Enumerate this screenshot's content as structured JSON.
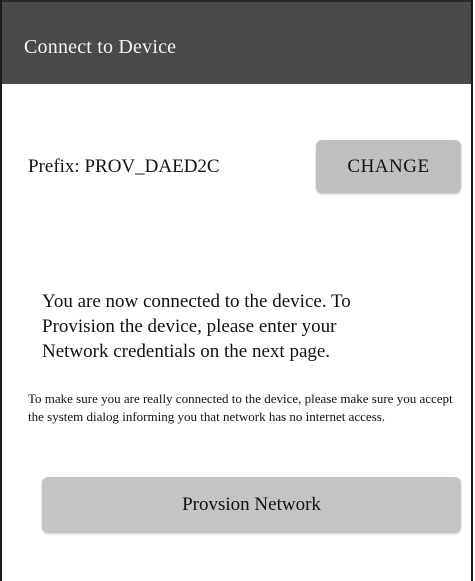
{
  "header": {
    "title": "Connect to Device"
  },
  "prefix": {
    "text": "Prefix: PROV_DAED2C",
    "change_label": "CHANGE"
  },
  "message": {
    "primary": "You are now connected to the device. To Provision the device, please enter your Network credentials on the next page.",
    "secondary": "To make sure you are really connected to the device, please make sure you accept the system dialog informing you that network has no internet access."
  },
  "actions": {
    "provision_label": "Provsion Network"
  },
  "colors": {
    "header_bg": "#4a4a4a",
    "button_bg": "#bfbfbf",
    "text": "#111111"
  }
}
